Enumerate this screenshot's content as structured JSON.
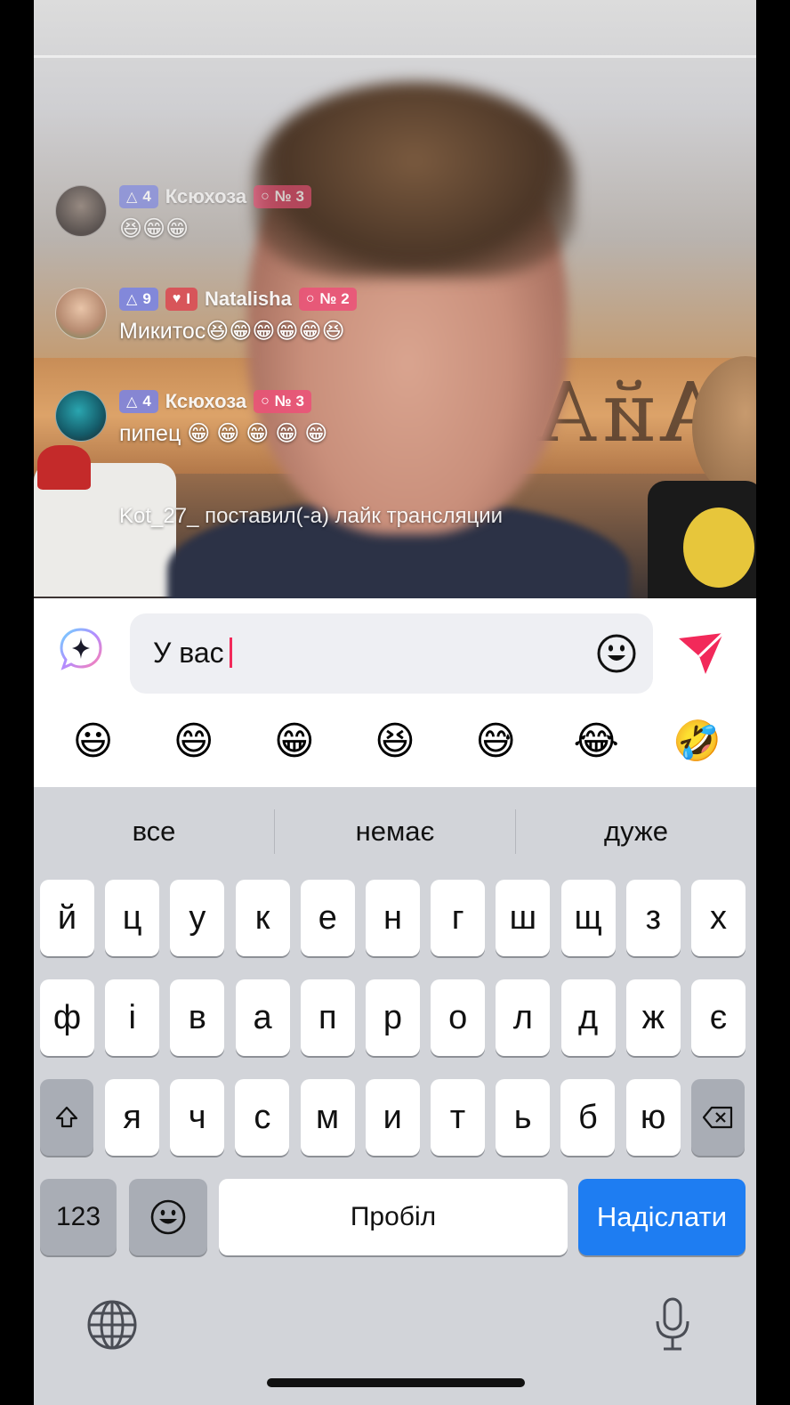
{
  "chat": {
    "messages": [
      {
        "level": "4",
        "nick": "Ксюхоза",
        "rank": "№ 3",
        "text": "😆😁😁"
      },
      {
        "level": "9",
        "heart": "I",
        "nick": "Natalisha",
        "rank": "№ 2",
        "text": "Микитос😆😁😁😁😁😆"
      },
      {
        "level": "4",
        "nick": "Ксюхоза",
        "rank": "№ 3",
        "text": "пипец 😁 😁 😁 😁 😁"
      }
    ],
    "system_message": "Kot_27_ поставил(-а) лайк трансляции"
  },
  "video": {
    "sign": "ҮАйА"
  },
  "input": {
    "value": "У вас",
    "ai_icon": "sparkle-bubble-icon",
    "emoji_icon": "smiley-icon",
    "send_icon": "send-arrow-icon",
    "accent": "#f2295a"
  },
  "emoji_bar": [
    "😃",
    "😄",
    "😁",
    "😆",
    "😅",
    "😂",
    "🤣"
  ],
  "keyboard": {
    "suggestions": [
      "все",
      "немає",
      "дуже"
    ],
    "row1": [
      "й",
      "ц",
      "у",
      "к",
      "е",
      "н",
      "г",
      "ш",
      "щ",
      "з",
      "х"
    ],
    "row2": [
      "ф",
      "і",
      "в",
      "а",
      "п",
      "р",
      "о",
      "л",
      "д",
      "ж",
      "є"
    ],
    "row3": [
      "я",
      "ч",
      "с",
      "м",
      "и",
      "т",
      "ь",
      "б",
      "ю"
    ],
    "numbers_label": "123",
    "space_label": "Пробіл",
    "send_label": "Надіслати",
    "send_color": "#1e7df2"
  }
}
